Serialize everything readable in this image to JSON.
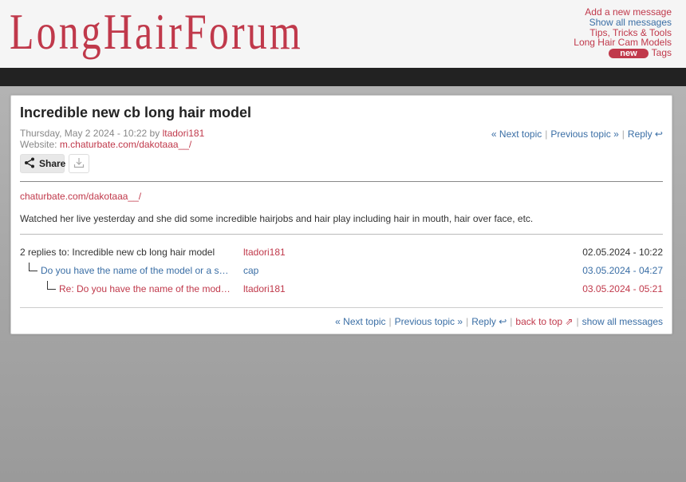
{
  "header": {
    "logo": "LongHairForum",
    "nav": {
      "add_message": "Add a new message",
      "show_all": "Show all messages",
      "tips": "Tips, Tricks & Tools",
      "cam_models": "Long Hair Cam Models",
      "new_badge": "new",
      "tags": "Tags"
    }
  },
  "post": {
    "title": "Incredible new cb long hair model",
    "date": "Thursday, May 2 2024 - 10:22",
    "by_label": "by",
    "author": "ltadori181",
    "website_label": "Website:",
    "website": "m.chaturbate.com/dakotaaa__/",
    "share_label": "Share",
    "link": "chaturbate.com/dakotaaa__/",
    "body": "Watched her live yesterday and she did some incredible hairjobs and hair play including hair in mouth, hair over face, etc."
  },
  "topnav": {
    "next": "« Next topic",
    "previous": "Previous topic »",
    "reply": "Reply ↩"
  },
  "thread": {
    "header": "2 replies to: Incredible new cb long hair model",
    "root_user": "ltadori181",
    "root_date": "02.05.2024 - 10:22",
    "replies": [
      {
        "subject": "Do you have the name of the model or a screenshot?",
        "user": "cap",
        "date": "03.05.2024 - 04:27"
      },
      {
        "subject": "Re: Do you have the name of the model or a screenshot?",
        "user": "ltadori181",
        "date": "03.05.2024 - 05:21"
      }
    ]
  },
  "botnav": {
    "next": "« Next topic",
    "previous": "Previous topic »",
    "reply": "Reply ↩",
    "back_to_top": "back to top ⇗",
    "show_all": "show all messages"
  },
  "colors": {
    "accent": "#c0394b",
    "link": "#3a6ea5"
  }
}
